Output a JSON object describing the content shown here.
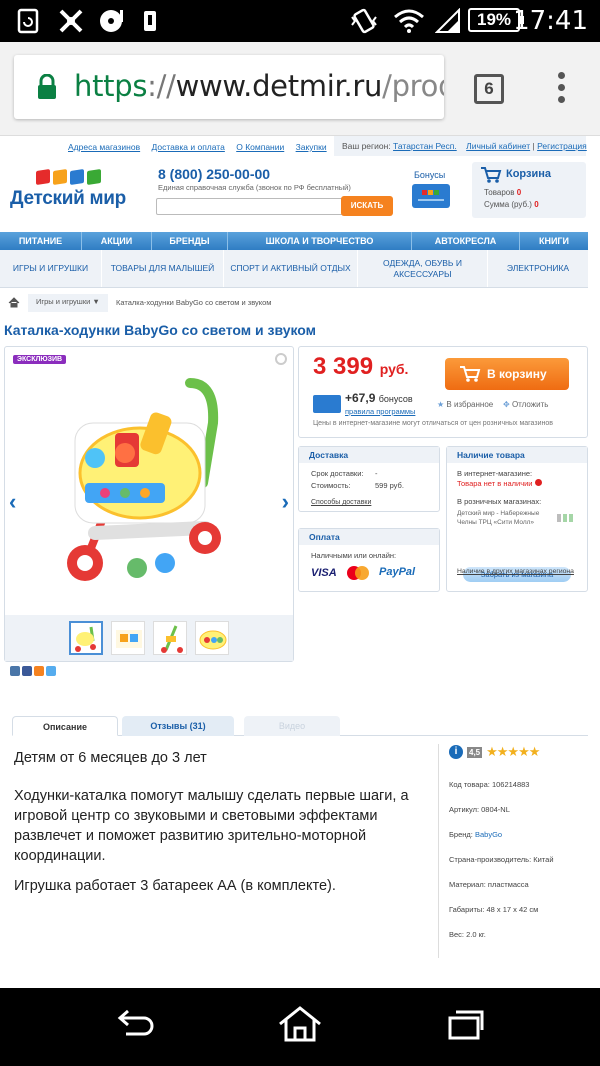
{
  "statusbar": {
    "battery": "19%",
    "time": "17:41"
  },
  "browser": {
    "url_scheme": "https",
    "url_sep": "://",
    "url_host": "www.detmir.ru",
    "url_path": "/produc",
    "tab_count": "6"
  },
  "header": {
    "top_links": [
      "Адреса магазинов",
      "Доставка и оплата",
      "О Компании",
      "Закупки"
    ],
    "region_label": "Ваш регион:",
    "region_value": "Татарстан Респ.",
    "account": "Личный кабинет",
    "separator": "|",
    "register": "Регистрация",
    "logo_text": "Детский мир",
    "phone": "8 (800) 250-00-00",
    "phone_note": "Единая справочная служба (звонок по РФ бесплатный)",
    "search_button": "ИСКАТЬ",
    "bonus_label": "Бонусы",
    "cart_title": "Корзина",
    "cart_items_label": "Товаров",
    "cart_items": "0",
    "cart_sum_label": "Сумма (руб.)",
    "cart_sum": "0"
  },
  "nav1": [
    "ПИТАНИЕ",
    "АКЦИИ",
    "БРЕНДЫ",
    "ШКОЛА И ТВОРЧЕСТВО",
    "АВТОКРЕСЛА",
    "КНИГИ"
  ],
  "nav2": [
    "ИГРЫ И ИГРУШКИ",
    "ТОВАРЫ ДЛЯ МАЛЫШЕЙ",
    "СПОРТ И АКТИВНЫЙ ОТДЫХ",
    "ОДЕЖДА, ОБУВЬ И АКСЕССУАРЫ",
    "ЭЛЕКТРОНИКА"
  ],
  "breadcrumb": {
    "category": "Игры и игрушки ▼",
    "current": "Каталка-ходунки BabyGo со светом и звуком"
  },
  "product": {
    "title": "Каталка-ходунки BabyGo со светом и звуком",
    "badge": "ЭКСКЛЮЗИВ",
    "price": "3 399",
    "currency": "руб.",
    "to_cart": "В корзину",
    "bonus": "+67,9",
    "bonus_unit": "бонусов",
    "program_rules": "правила программы",
    "favorites": "В избранное",
    "later": "Отложить",
    "price_note": "Цены в интернет-магазине могут отличаться от цен розничных магазинов"
  },
  "delivery": {
    "title": "Доставка",
    "term_label": "Срок доставки:",
    "term_value": "-",
    "cost_label": "Стоимость:",
    "cost_value": "599 руб.",
    "methods_link": "Способы доставки"
  },
  "payment": {
    "title": "Оплата",
    "label": "Наличными или онлайн:",
    "visa": "VISA",
    "paypal": "PayPal"
  },
  "availability": {
    "title": "Наличие товара",
    "online_label": "В интернет-магазине:",
    "online_value": "Товара нет в наличии",
    "retail_label": "В розничных магазинах:",
    "store_name": "Детский мир - Набережные Челны ТРЦ «Сити Молл»",
    "pickup_button": "Забрать из магазина",
    "other_regions": "Наличие в других магазинах региона"
  },
  "tabs": [
    "Описание",
    "Отзывы (31)",
    "Видео"
  ],
  "description": [
    "Детям от 6 месяцев до 3 лет",
    "Ходунки-каталка помогут малышу сделать первые шаги, а игровой центр со звуковыми и световыми эффектами развлечет и поможет развитию зрительно-моторной координации.",
    "Игрушка работает 3 батареек АА (в комплекте)."
  ],
  "specs": {
    "score": "4,5",
    "rating": 4.5,
    "sku": "Код товара: 106214883",
    "article": "Артикул: 0804-NL",
    "brand_label": "Бренд:",
    "brand": "BabyGo",
    "country": "Страна-производитель: Китай",
    "material": "Материал: пластмасса",
    "size": "Габариты: 48 x 17 x 42 см",
    "weight": "Вес: 2.0 кг."
  }
}
